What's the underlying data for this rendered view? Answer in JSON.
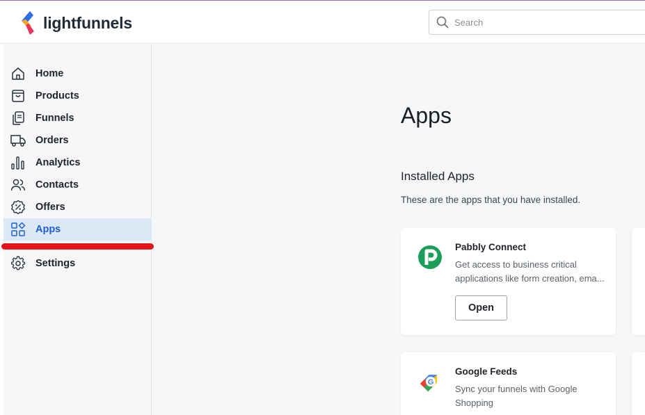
{
  "brand": {
    "name": "lightfunnels"
  },
  "search": {
    "placeholder": "Search"
  },
  "sidebar": {
    "items": [
      {
        "label": "Home",
        "icon": "home-icon"
      },
      {
        "label": "Products",
        "icon": "shopping-bag-icon"
      },
      {
        "label": "Funnels",
        "icon": "funnel-pages-icon"
      },
      {
        "label": "Orders",
        "icon": "truck-icon"
      },
      {
        "label": "Analytics",
        "icon": "bar-chart-icon"
      },
      {
        "label": "Contacts",
        "icon": "users-icon"
      },
      {
        "label": "Offers",
        "icon": "discount-badge-icon"
      },
      {
        "label": "Apps",
        "icon": "apps-grid-icon",
        "active": true
      },
      {
        "label": "Settings",
        "icon": "gear-icon"
      }
    ]
  },
  "main": {
    "title": "Apps",
    "section": {
      "title": "Installed Apps",
      "subtitle": "These are the apps that you have installed."
    },
    "apps": [
      {
        "name": "Pabbly Connect",
        "description_lines": [
          "Get access to business critical",
          "applications like form creation, ema..."
        ],
        "button": "Open",
        "icon": "pabbly-logo-icon"
      },
      {
        "name": "Google Feeds",
        "description_lines": [
          "Sync your funnels with Google",
          "Shopping"
        ],
        "icon": "google-tag-icon"
      }
    ]
  },
  "colors": {
    "accent": "#1f5fd1",
    "active_bg": "#dde8f7",
    "annotation_red": "#e0161b",
    "pabbly_green": "#1a9f5a"
  }
}
